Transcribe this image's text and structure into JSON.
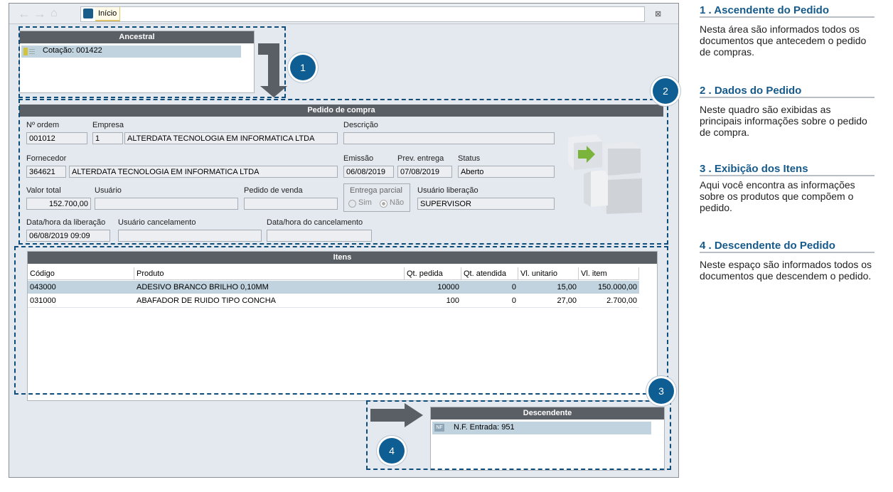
{
  "toolbar": {
    "tab_label": "Início",
    "close_label": "⊠"
  },
  "ancestral": {
    "title": "Ancestral",
    "item_label": "Cotação: 001422"
  },
  "pedido": {
    "title": "Pedido de compra",
    "labels": {
      "num_ordem": "Nº ordem",
      "empresa": "Empresa",
      "descricao": "Descrição",
      "fornecedor": "Fornecedor",
      "emissao": "Emissão",
      "prev_entrega": "Prev. entrega",
      "status": "Status",
      "valor_total": "Valor total",
      "usuario": "Usuário",
      "pedido_venda": "Pedido de venda",
      "entrega_parcial": "Entrega parcial",
      "sim": "Sim",
      "nao": "Não",
      "usuario_liberacao": "Usuário liberação",
      "data_liberacao": "Data/hora da liberação",
      "usuario_cancelamento": "Usuário cancelamento",
      "data_cancelamento": "Data/hora do cancelamento"
    },
    "values": {
      "num_ordem": "001012",
      "empresa_cod": "1",
      "empresa_nome": "ALTERDATA TECNOLOGIA EM INFORMATICA LTDA",
      "descricao": "",
      "fornecedor_cod": "364621",
      "fornecedor_nome": "ALTERDATA TECNOLOGIA EM INFORMATICA LTDA",
      "emissao": "06/08/2019",
      "prev_entrega": "07/08/2019",
      "status": "Aberto",
      "valor_total": "152.700,00",
      "usuario": "",
      "pedido_venda": "",
      "usuario_liberacao": "SUPERVISOR",
      "data_liberacao": "06/08/2019 09:09",
      "usuario_cancelamento": "",
      "data_cancelamento": ""
    }
  },
  "itens": {
    "title": "Itens",
    "columns": [
      "Código",
      "Produto",
      "Qt. pedida",
      "Qt. atendida",
      "Vl. unitario",
      "Vl. item"
    ],
    "rows": [
      [
        "043000",
        "ADESIVO BRANCO BRILHO 0,10MM",
        "10000",
        "0",
        "15,00",
        "150.000,00"
      ],
      [
        "031000",
        "ABAFADOR DE RUIDO TIPO CONCHA",
        "100",
        "0",
        "27,00",
        "2.700,00"
      ]
    ]
  },
  "descendente": {
    "title": "Descendente",
    "item_badge": "NF",
    "item_label": "N.F. Entrada: 951"
  },
  "markers": [
    "1",
    "2",
    "3",
    "4"
  ],
  "sidebar": [
    {
      "title": "1 . Ascendente do Pedido",
      "text": "Nesta área são informados todos os documentos que antecedem o pedido de compras."
    },
    {
      "title": "2 . Dados do Pedido",
      "text": "Neste quadro são exibidas as principais informações sobre o pedido de compra."
    },
    {
      "title": "3 . Exibição dos Itens",
      "text": "Aqui você encontra as informações sobre os produtos que compõem o pedido."
    },
    {
      "title": "4 . Descendente do Pedido",
      "text": "Neste espaço são informados todos os documentos que descendem o pedido."
    }
  ],
  "colors": {
    "accent": "#0f5e93",
    "header": "#5a5f66",
    "selection": "#c1d3df"
  }
}
